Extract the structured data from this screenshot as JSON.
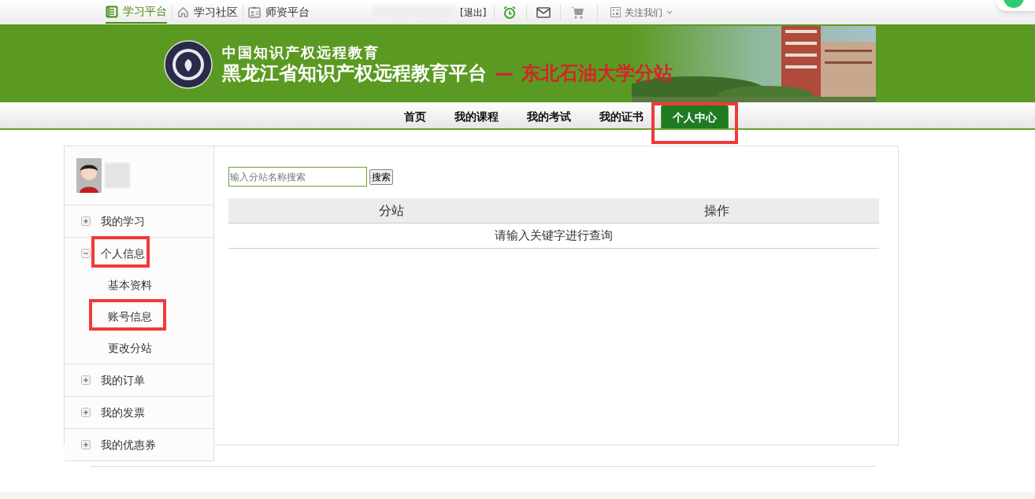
{
  "top_bar": {
    "links": [
      {
        "label": "学习平台",
        "selected": true
      },
      {
        "label": "学习社区",
        "selected": false
      },
      {
        "label": "师资平台",
        "selected": false
      }
    ],
    "logout": "[退出]",
    "follow": "关注我们"
  },
  "banner": {
    "subtitle": "中国知识产权远程教育",
    "title": "黑龙江省知识产权远程教育平台",
    "dash": "—",
    "branch": "东北石油大学分站"
  },
  "nav": [
    {
      "label": "首页",
      "selected": false,
      "highlighted": false
    },
    {
      "label": "我的课程",
      "selected": false,
      "highlighted": false
    },
    {
      "label": "我的考试",
      "selected": false,
      "highlighted": false
    },
    {
      "label": "我的证书",
      "selected": false,
      "highlighted": false
    },
    {
      "label": "个人中心",
      "selected": true,
      "highlighted": true
    }
  ],
  "sidebar": {
    "items": [
      {
        "label": "我的学习",
        "expanded": false,
        "highlighted": false
      },
      {
        "label": "个人信息",
        "expanded": true,
        "highlighted": true,
        "children": [
          {
            "label": "基本资料",
            "highlighted": false
          },
          {
            "label": "账号信息",
            "highlighted": true
          },
          {
            "label": "更改分站",
            "highlighted": false
          }
        ]
      },
      {
        "label": "我的订单",
        "expanded": false,
        "highlighted": false
      },
      {
        "label": "我的发票",
        "expanded": false,
        "highlighted": false
      },
      {
        "label": "我的优惠券",
        "expanded": false,
        "highlighted": false
      }
    ]
  },
  "search": {
    "placeholder": "输入分站名称搜索",
    "button": "搜索"
  },
  "table": {
    "columns": [
      "分站",
      "操作"
    ],
    "empty_message": "请输入关键字进行查询"
  }
}
